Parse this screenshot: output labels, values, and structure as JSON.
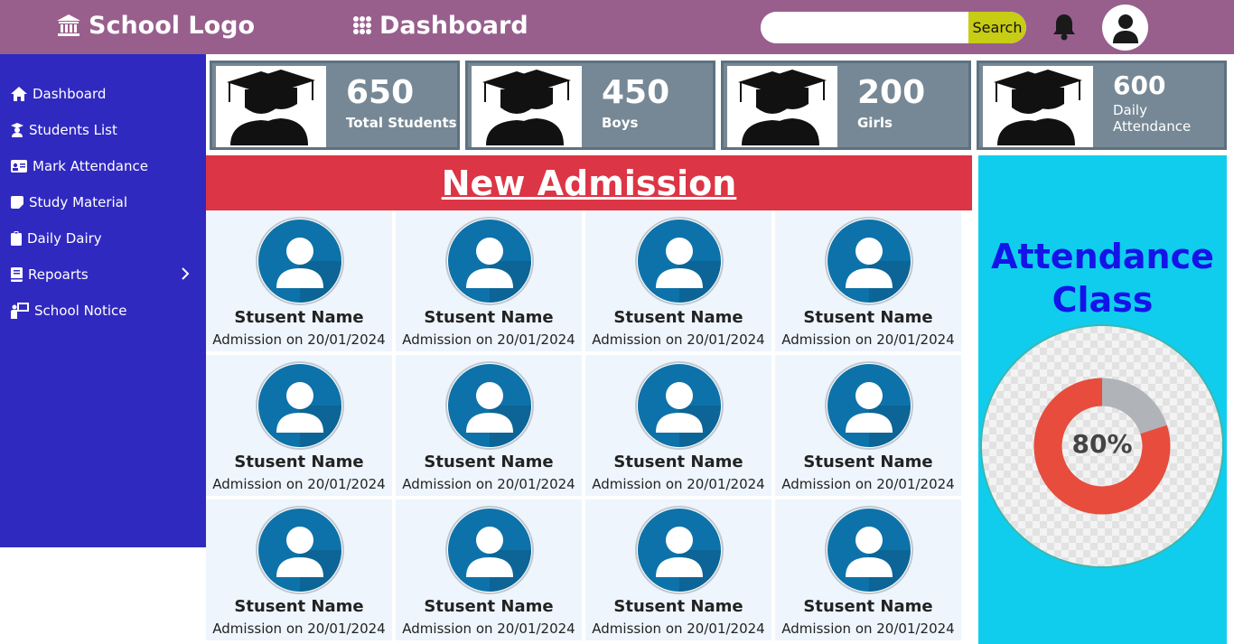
{
  "header": {
    "logo_text": "School Logo",
    "page_title": "Dashboard",
    "search_placeholder": "",
    "search_button": "Search"
  },
  "sidebar": {
    "items": [
      {
        "label": "Dashboard",
        "icon": "home-icon"
      },
      {
        "label": "Students List",
        "icon": "student-icon"
      },
      {
        "label": "Mark Attendance",
        "icon": "id-card-icon"
      },
      {
        "label": "Study Material",
        "icon": "note-icon"
      },
      {
        "label": "Daily Dairy",
        "icon": "clipboard-icon"
      },
      {
        "label": "Repoarts",
        "icon": "book-icon",
        "has_submenu": true
      },
      {
        "label": "School Notice",
        "icon": "teacher-board-icon"
      }
    ]
  },
  "stats": [
    {
      "value": "650",
      "label": "Total Students"
    },
    {
      "value": "450",
      "label": "Boys"
    },
    {
      "value": "200",
      "label": "Girls"
    },
    {
      "value": "600",
      "label": "Daily Attendance"
    }
  ],
  "admissions": {
    "title": "New Admission",
    "students": [
      {
        "name": "Stusent Name",
        "date": "Admission on 20/01/2024"
      },
      {
        "name": "Stusent Name",
        "date": "Admission on 20/01/2024"
      },
      {
        "name": "Stusent Name",
        "date": "Admission on 20/01/2024"
      },
      {
        "name": "Stusent Name",
        "date": "Admission on 20/01/2024"
      },
      {
        "name": "Stusent Name",
        "date": "Admission on 20/01/2024"
      },
      {
        "name": "Stusent Name",
        "date": "Admission on 20/01/2024"
      },
      {
        "name": "Stusent Name",
        "date": "Admission on 20/01/2024"
      },
      {
        "name": "Stusent Name",
        "date": "Admission on 20/01/2024"
      },
      {
        "name": "Stusent Name",
        "date": "Admission on 20/01/2024"
      },
      {
        "name": "Stusent Name",
        "date": "Admission on 20/01/2024"
      },
      {
        "name": "Stusent Name",
        "date": "Admission on 20/01/2024"
      },
      {
        "name": "Stusent Name",
        "date": "Admission on 20/01/2024"
      }
    ]
  },
  "attendance": {
    "title_line1": "Attendance",
    "title_line2": "Class",
    "percent_label": "80%",
    "percent_value": 0.8,
    "colors": {
      "filled": "#e74c3c",
      "remaining": "#b0b3b8"
    }
  },
  "colors": {
    "topbar": "#985f8d",
    "sidebar": "#3029c0",
    "stat_card": "#768895",
    "admission_header": "#dc3545",
    "attendance_panel": "#10cdee",
    "attendance_title": "#1414e8",
    "search_button": "#c7cc14"
  }
}
